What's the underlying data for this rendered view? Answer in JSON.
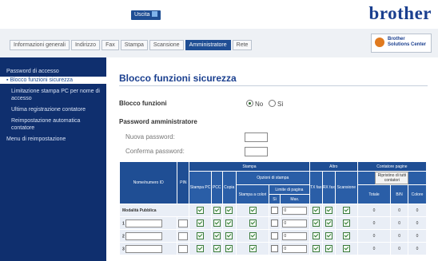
{
  "header": {
    "logout_label": "Uscita",
    "brand": "brother"
  },
  "tabs": [
    {
      "label": "Informazioni generali"
    },
    {
      "label": "Indirizzo"
    },
    {
      "label": "Fax"
    },
    {
      "label": "Stampa"
    },
    {
      "label": "Scansione"
    },
    {
      "label": "Amministratore",
      "active": true
    },
    {
      "label": "Rete"
    }
  ],
  "solutions": {
    "line1": "Brother",
    "line2": "Solutions Center"
  },
  "sidebar": {
    "items": [
      {
        "label": "Password di accesso"
      },
      {
        "label": "Blocco funzioni sicurezza",
        "active": true
      },
      {
        "label": "Limitazione stampa PC per nome di accesso"
      },
      {
        "label": "Ultima registrazione contatore"
      },
      {
        "label": "Reimpostazione automatica contatore"
      },
      {
        "label": "Menu di reimpostazione"
      }
    ]
  },
  "main": {
    "title": "Blocco funzioni sicurezza",
    "lock_label": "Blocco funzioni",
    "radio_no": "No",
    "radio_si": "Sì",
    "admin_password_label": "Password amministratore",
    "new_password_label": "Nuova password:",
    "confirm_password_label": "Conferma password:"
  },
  "table": {
    "h_id": "Nome/numero ID",
    "h_pin": "PIN",
    "h_stampa": "Stampa",
    "h_altro": "Altro",
    "h_contatore": "Contatore pagine",
    "h_stampa_pc": "Stampa PC",
    "h_pcc": "PCC",
    "h_copia": "Copia",
    "h_opzioni": "Opzioni di stampa",
    "h_tx": "TX fax",
    "h_rx": "RX fax",
    "h_scansione": "Scansione",
    "h_reset": "Ripristino di tutti contatori",
    "h_stampa_colori": "Stampa a colori",
    "h_limite": "Limite di pagina",
    "h_si": "Sì",
    "h_max": "Max.",
    "h_totale": "Totale",
    "h_bn": "B/N",
    "h_colore": "Colore",
    "rows": [
      {
        "name": "Modalità Pubblica",
        "max": "0",
        "totale": "0",
        "bn": "0",
        "colore": "0"
      },
      {
        "name": "1",
        "max": "0",
        "totale": "0",
        "bn": "0",
        "colore": "0"
      },
      {
        "name": "2",
        "max": "0",
        "totale": "0",
        "bn": "0",
        "colore": "0"
      },
      {
        "name": "3",
        "max": "0",
        "totale": "0",
        "bn": "0",
        "colore": "0"
      }
    ]
  }
}
